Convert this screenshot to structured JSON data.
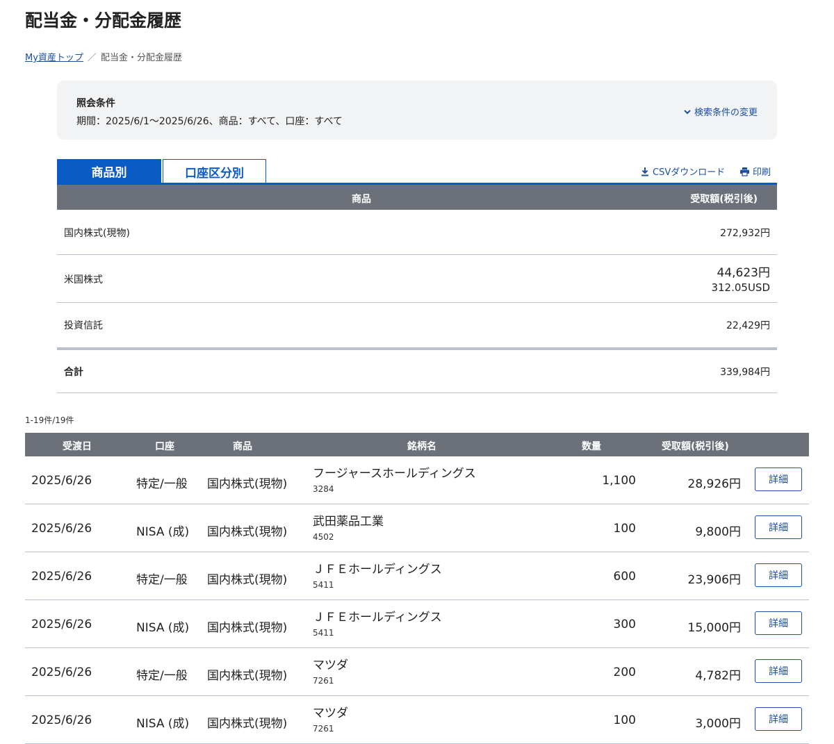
{
  "page": {
    "title": "配当金・分配金履歴"
  },
  "breadcrumb": {
    "home": "My資産トップ",
    "separator": "／",
    "current": "配当金・分配金履歴"
  },
  "conditions": {
    "heading": "照会条件",
    "detail": "期間：2025/6/1〜2025/6/26、商品：すべて、口座：すべて",
    "change_label": "検索条件の変更"
  },
  "tabs": [
    {
      "label": "商品別",
      "active": true
    },
    {
      "label": "口座区分別",
      "active": false
    }
  ],
  "actions": {
    "csv_label": "CSVダウンロード",
    "print_label": "印刷"
  },
  "summary": {
    "headers": {
      "product": "商品",
      "amount": "受取額(税引後)"
    },
    "rows": [
      {
        "label": "国内株式(現物)",
        "amount": "272,932円",
        "sub": ""
      },
      {
        "label": "米国株式",
        "amount": "44,623円",
        "sub": "312.05USD"
      },
      {
        "label": "投資信託",
        "amount": "22,429円",
        "sub": ""
      }
    ],
    "total": {
      "label": "合計",
      "amount": "339,984円"
    }
  },
  "result_count": "1-19件/19件",
  "details": {
    "headers": {
      "date": "受渡日",
      "account": "口座",
      "product": "商品",
      "name": "銘柄名",
      "qty": "数量",
      "amount": "受取額(税引後)"
    },
    "button_label": "詳細",
    "rows": [
      {
        "date": "2025/6/26",
        "account": "特定/一般",
        "product": "国内株式(現物)",
        "name": "フージャースホールディングス",
        "code": "3284",
        "qty": "1,100",
        "amount": "28,926円"
      },
      {
        "date": "2025/6/26",
        "account": "NISA (成)",
        "product": "国内株式(現物)",
        "name": "武田薬品工業",
        "code": "4502",
        "qty": "100",
        "amount": "9,800円"
      },
      {
        "date": "2025/6/26",
        "account": "特定/一般",
        "product": "国内株式(現物)",
        "name": "ＪＦＥホールディングス",
        "code": "5411",
        "qty": "600",
        "amount": "23,906円"
      },
      {
        "date": "2025/6/26",
        "account": "NISA (成)",
        "product": "国内株式(現物)",
        "name": "ＪＦＥホールディングス",
        "code": "5411",
        "qty": "300",
        "amount": "15,000円"
      },
      {
        "date": "2025/6/26",
        "account": "特定/一般",
        "product": "国内株式(現物)",
        "name": "マツダ",
        "code": "7261",
        "qty": "200",
        "amount": "4,782円"
      },
      {
        "date": "2025/6/26",
        "account": "NISA (成)",
        "product": "国内株式(現物)",
        "name": "マツダ",
        "code": "7261",
        "qty": "100",
        "amount": "3,000円"
      }
    ]
  }
}
